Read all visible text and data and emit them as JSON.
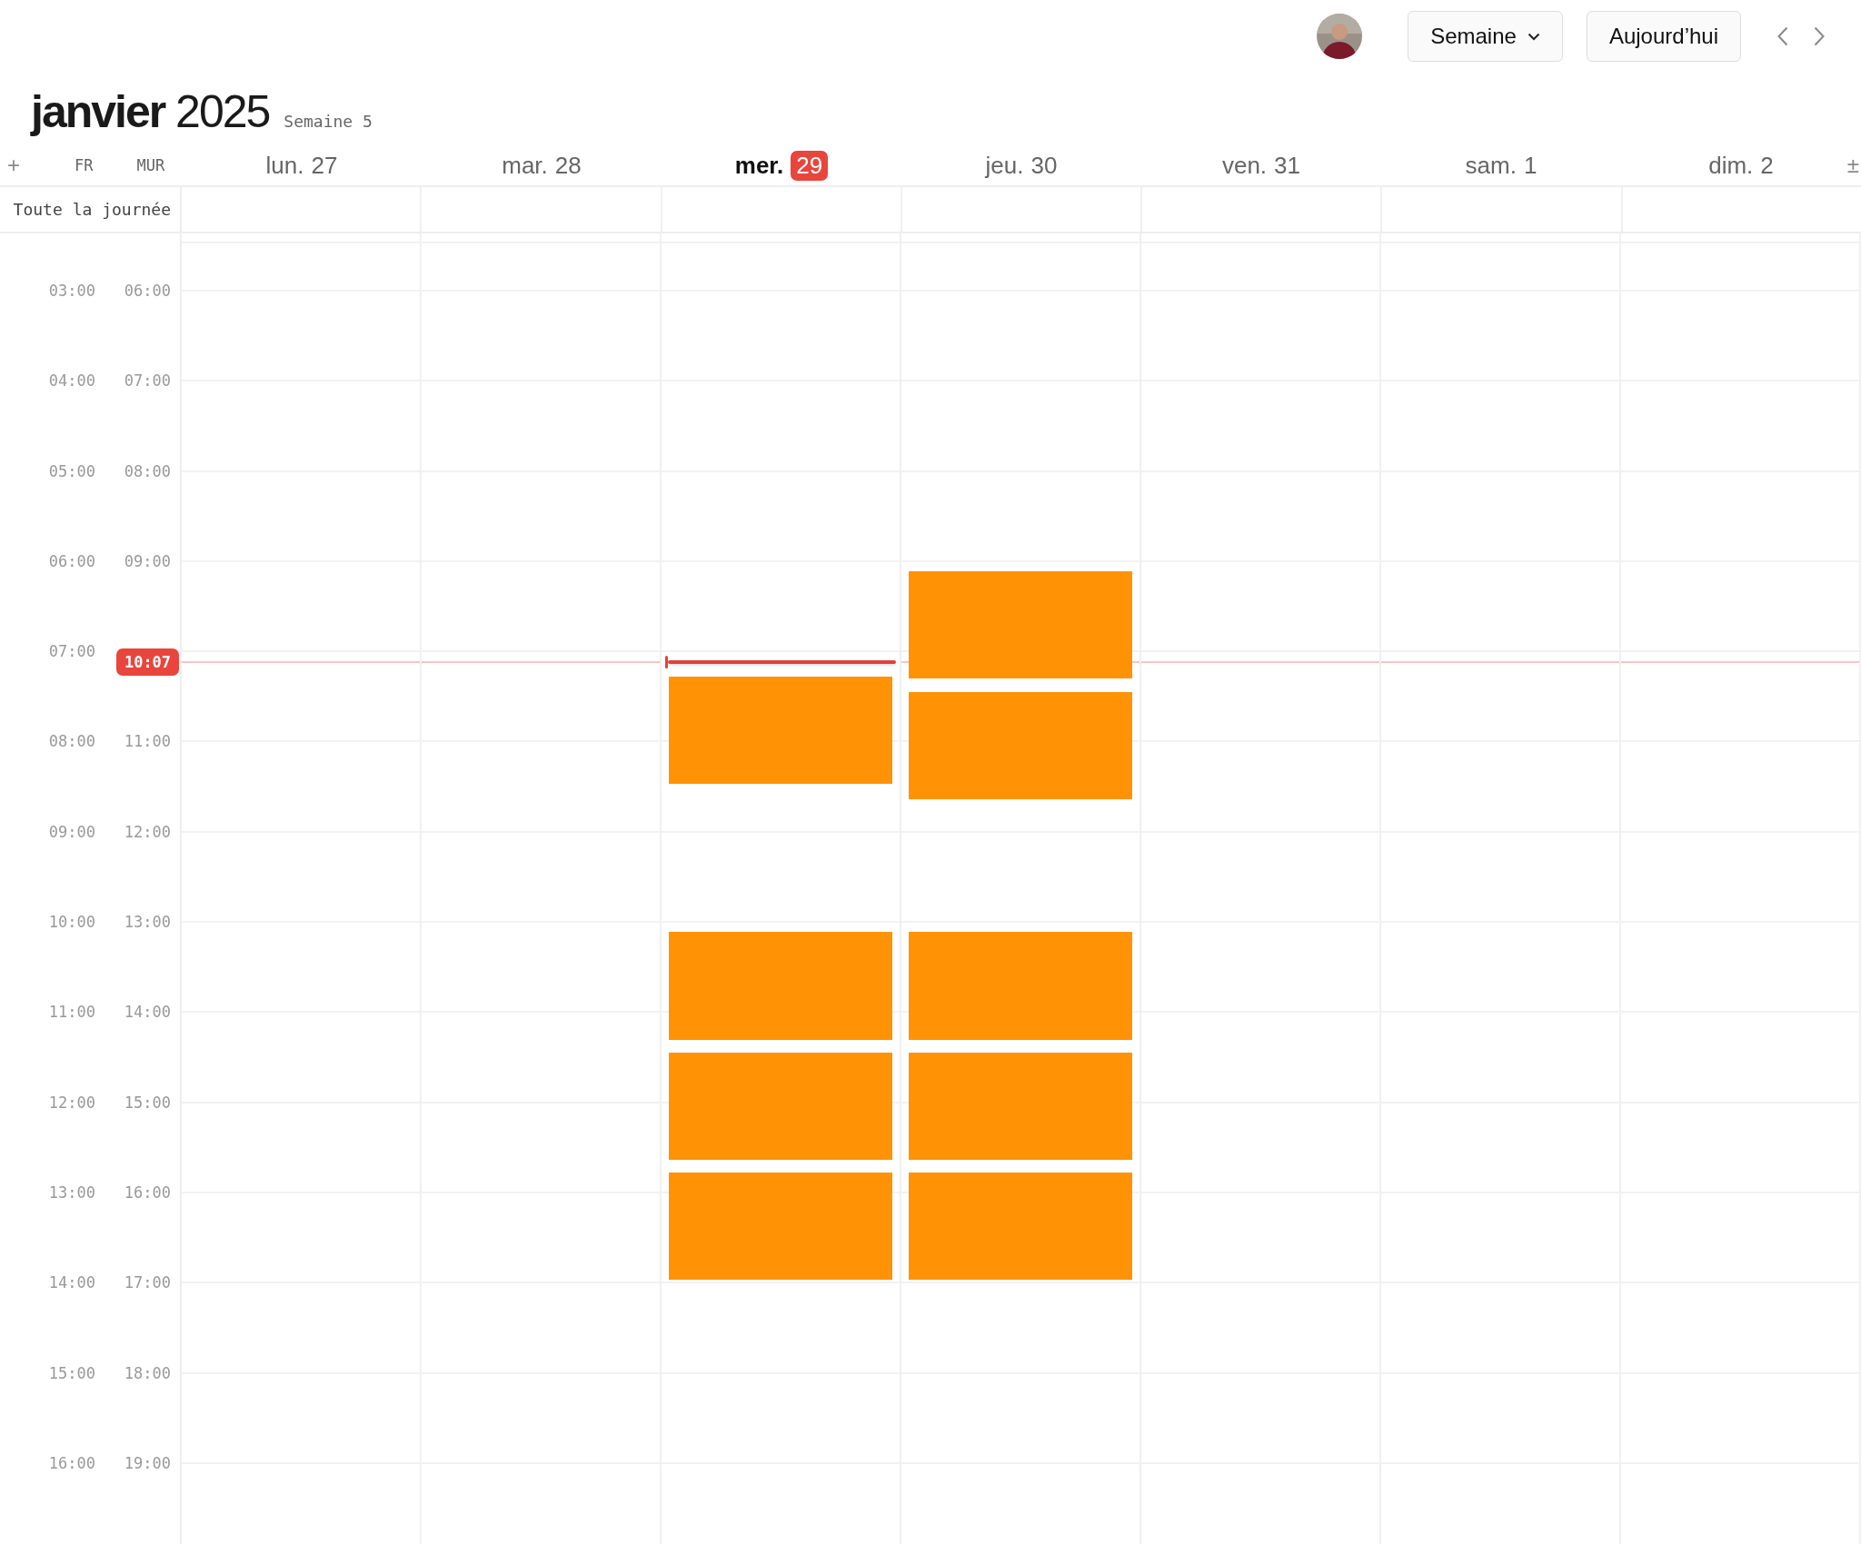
{
  "toolbar": {
    "view_button": "Semaine",
    "today_button": "Aujourd’hui"
  },
  "title": {
    "text": "**janvier** 2025",
    "week": "Semaine 5"
  },
  "timezones": {
    "add": "+",
    "labels": [
      "FR",
      "MUR"
    ],
    "toggle": "±"
  },
  "days": [
    {
      "name": "lun.",
      "number": "27",
      "selected": false
    },
    {
      "name": "mar.",
      "number": "28",
      "selected": false
    },
    {
      "name": "mer.",
      "number": "29",
      "selected": true
    },
    {
      "name": "jeu.",
      "number": "30",
      "selected": false
    },
    {
      "name": "ven.",
      "number": "31",
      "selected": false
    },
    {
      "name": "sam.",
      "number": "1",
      "selected": false
    },
    {
      "name": "dim.",
      "number": "2",
      "selected": false
    }
  ],
  "all_day_label": "Toute la journée",
  "hours": [
    {
      "left": "03:00",
      "right": "06:00"
    },
    {
      "left": "04:00",
      "right": "07:00"
    },
    {
      "left": "05:00",
      "right": "08:00"
    },
    {
      "left": "06:00",
      "right": "09:00"
    },
    {
      "left": "07:00"
    },
    {
      "left": "08:00",
      "right": "11:00"
    },
    {
      "left": "09:00",
      "right": "12:00"
    },
    {
      "left": "10:00",
      "right": "13:00"
    },
    {
      "left": "11:00",
      "right": "14:00"
    },
    {
      "left": "12:00",
      "right": "15:00"
    },
    {
      "left": "13:00",
      "right": "16:00"
    },
    {
      "left": "14:00",
      "right": "17:00"
    },
    {
      "left": "15:00",
      "right": "18:00"
    },
    {
      "left": "16:00",
      "right": "19:00"
    }
  ],
  "now": {
    "label": "10:07"
  }
}
